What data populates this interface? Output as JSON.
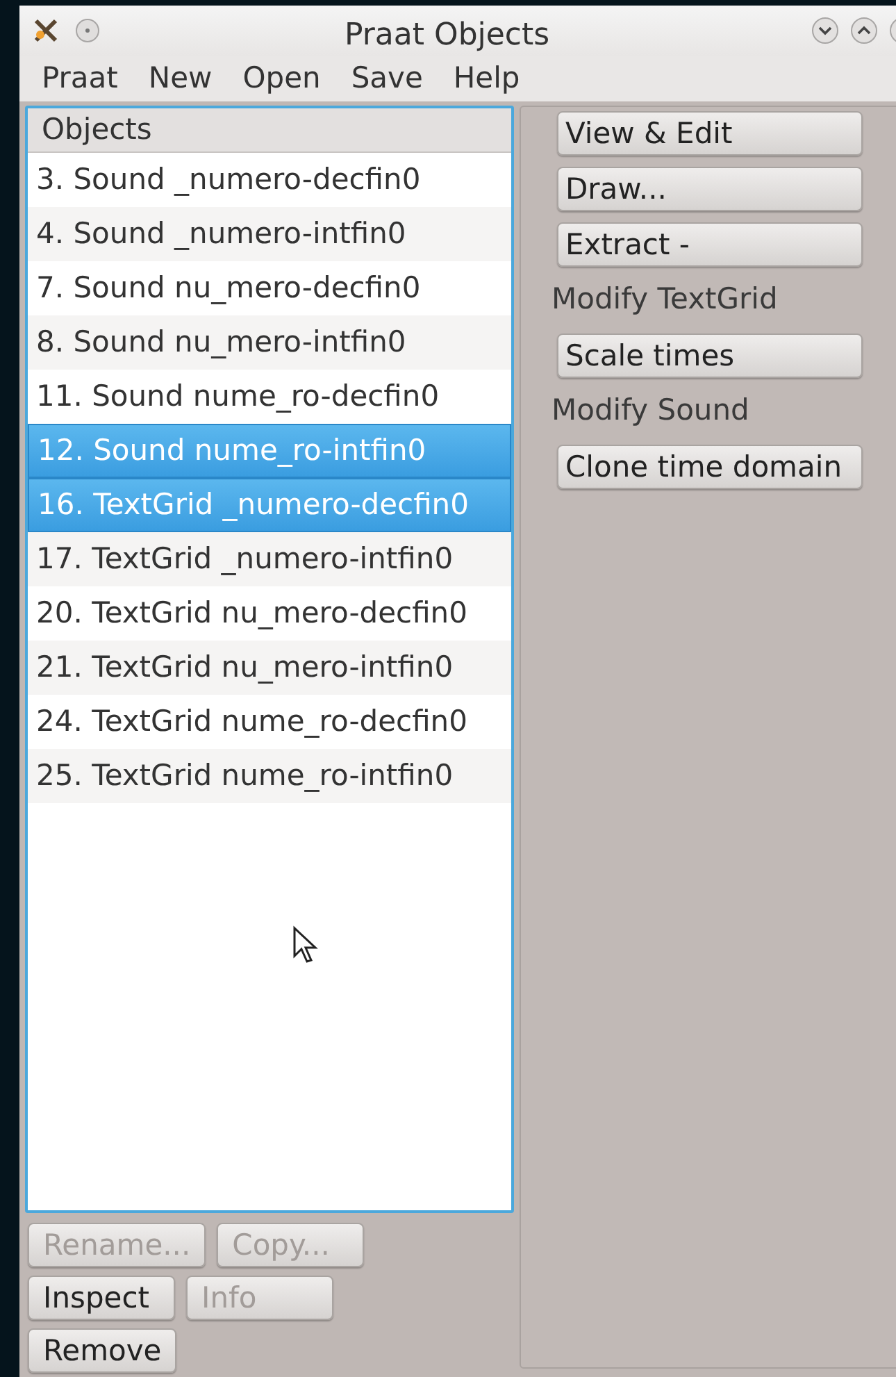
{
  "window": {
    "title": "Praat Objects"
  },
  "menu": [
    "Praat",
    "New",
    "Open",
    "Save",
    "Help"
  ],
  "objects": {
    "header": "Objects",
    "rows": [
      {
        "label": "3. Sound _numero-decfin0",
        "selected": false
      },
      {
        "label": "4. Sound _numero-intfin0",
        "selected": false
      },
      {
        "label": "7. Sound nu_mero-decfin0",
        "selected": false
      },
      {
        "label": "8. Sound nu_mero-intfin0",
        "selected": false
      },
      {
        "label": "11. Sound nume_ro-decfin0",
        "selected": false
      },
      {
        "label": "12. Sound nume_ro-intfin0",
        "selected": true
      },
      {
        "label": "16. TextGrid _numero-decfin0",
        "selected": true
      },
      {
        "label": "17. TextGrid _numero-intfin0",
        "selected": false
      },
      {
        "label": "20. TextGrid nu_mero-decfin0",
        "selected": false
      },
      {
        "label": "21. TextGrid nu_mero-intfin0",
        "selected": false
      },
      {
        "label": "24. TextGrid nume_ro-decfin0",
        "selected": false
      },
      {
        "label": "25. TextGrid nume_ro-intfin0",
        "selected": false
      }
    ]
  },
  "object_buttons": [
    [
      {
        "label": "Rename...",
        "disabled": true
      },
      {
        "label": "Copy...",
        "disabled": true
      }
    ],
    [
      {
        "label": "Inspect",
        "disabled": false
      },
      {
        "label": "Info",
        "disabled": true
      }
    ],
    [
      {
        "label": "Remove",
        "disabled": false
      }
    ]
  ],
  "actions": [
    {
      "kind": "button",
      "label": "View & Edit"
    },
    {
      "kind": "button",
      "label": "Draw..."
    },
    {
      "kind": "button",
      "label": "Extract -"
    },
    {
      "kind": "heading",
      "label": "Modify TextGrid"
    },
    {
      "kind": "button",
      "label": "Scale times"
    },
    {
      "kind": "heading",
      "label": "Modify Sound"
    },
    {
      "kind": "button",
      "label": "Clone time domain"
    }
  ]
}
